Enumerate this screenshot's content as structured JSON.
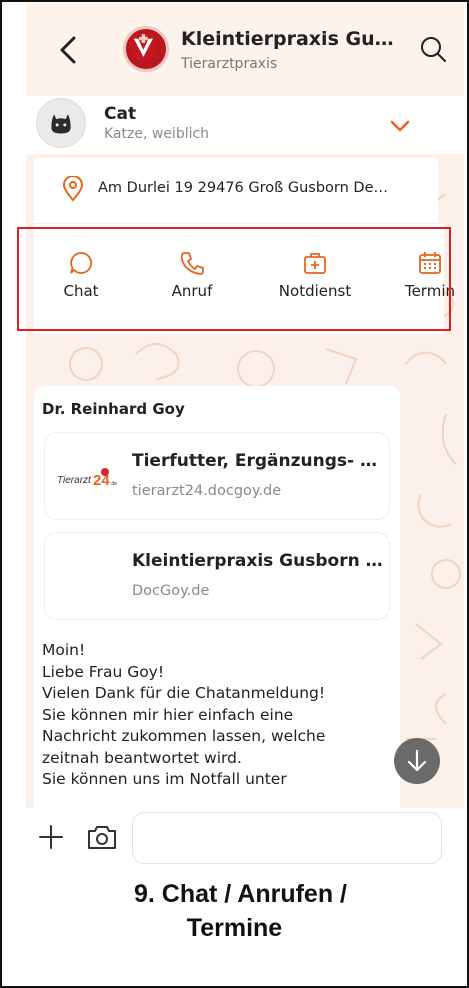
{
  "header": {
    "title": "Kleintierpraxis Gu…",
    "subtitle": "Tierarztpraxis",
    "icons": {
      "back": "chevron-left-icon",
      "logo": "practice-logo",
      "search": "search-icon"
    }
  },
  "pet": {
    "name": "Cat",
    "description": "Katze, weiblich",
    "icons": {
      "avatar": "cat-icon",
      "expand": "chevron-down-icon"
    }
  },
  "address": {
    "text": "Am Durlei 19 29476 Groß Gusborn De…",
    "icon": "location-pin-icon"
  },
  "actions": [
    {
      "label": "Chat",
      "icon": "chat-bubble-icon"
    },
    {
      "label": "Anruf",
      "icon": "phone-icon"
    },
    {
      "label": "Notdienst",
      "icon": "first-aid-kit-icon"
    },
    {
      "label": "Termin",
      "icon": "calendar-icon"
    }
  ],
  "message": {
    "sender": "Dr. Reinhard Goy",
    "links": [
      {
        "title": "Tierfutter, Ergänzungs- …",
        "domain": "tierarzt24.docgoy.de",
        "thumb_text": "Tierarzt24.de"
      },
      {
        "title": "Kleintierpraxis Gusborn …",
        "domain": "DocGoy.de"
      }
    ],
    "body": "Moin!\nLiebe Frau Goy!\nVielen Dank für die Chatanmeldung!\nSie können mir hier einfach eine\nNachricht zukommen lassen, welche\nzeitnah beantwortet wird.\nSie können uns im Notfall unter"
  },
  "input": {
    "placeholder": "",
    "icons": {
      "add": "plus-icon",
      "camera": "camera-icon",
      "scroll": "arrow-down-icon"
    }
  },
  "caption": {
    "line1": "9.  Chat / Anrufen /",
    "line2": "Termine"
  },
  "colors": {
    "accent": "#e8651f",
    "highlight_border": "#e02020",
    "background": "#fbf1ea",
    "header_bg": "#fdf3ec"
  }
}
